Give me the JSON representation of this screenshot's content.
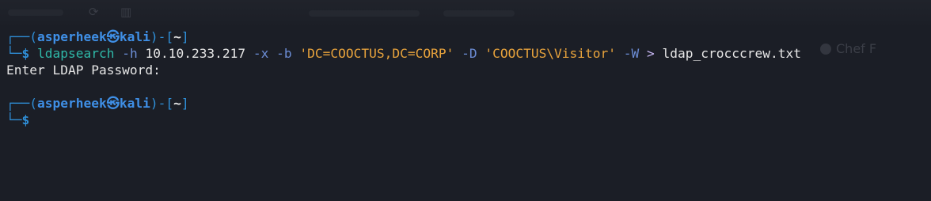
{
  "prompt": {
    "frame_top": "┌──(",
    "user": "asperheek",
    "at_symbol": "㉿",
    "host": "kali",
    "close_paren": ")-[",
    "cwd": "~",
    "close_bracket": "]",
    "frame_bottom": "└─",
    "dollar": "$"
  },
  "command": {
    "name": "ldapsearch",
    "flag_h": "-h",
    "host_ip": "10.10.233.217",
    "flag_x": "-x",
    "flag_b": "-b",
    "base_dn": "'DC=COOCTUS,DC=CORP'",
    "flag_D": "-D",
    "bind_dn": "'COOCTUS\\Visitor'",
    "flag_W": "-W",
    "redirect": ">",
    "outfile": "ldap_crocccrew.txt"
  },
  "output": {
    "line1": "Enter LDAP Password:"
  },
  "background_bleed": {
    "right_text": "Chef F"
  },
  "colors": {
    "background": "#1b1e26",
    "prompt_blue": "#3f8fe6",
    "command_teal": "#2fb8a8",
    "option_blue": "#6c8dd6",
    "string_orange": "#e8a33c",
    "redirect_violet": "#c8b8f4",
    "text": "#e6e6e6"
  }
}
